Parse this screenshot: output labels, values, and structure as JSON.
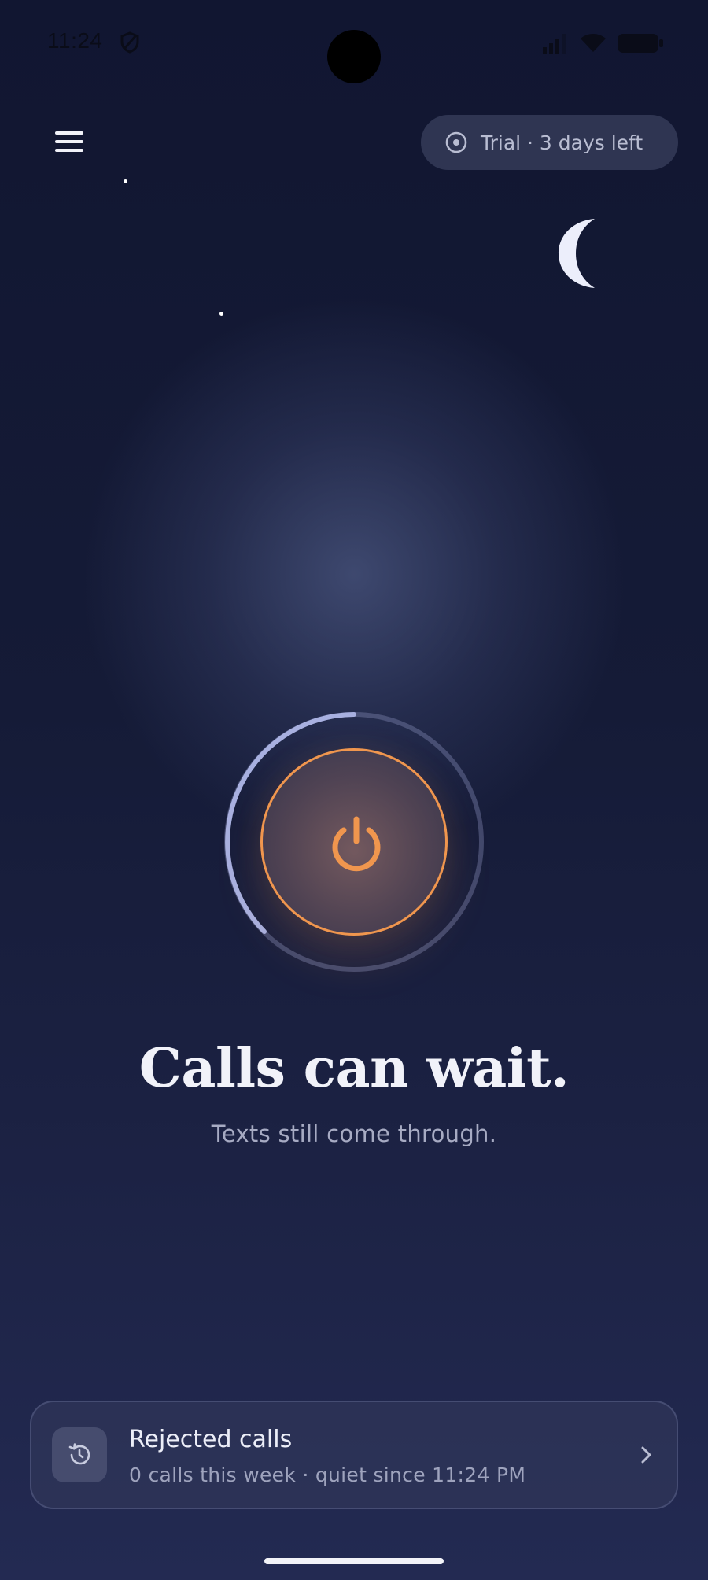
{
  "status_bar": {
    "time": "11:24",
    "icons": [
      "shield-icon",
      "signal-icon",
      "wifi-icon",
      "battery-icon"
    ]
  },
  "header": {
    "menu_icon": "hamburger-menu-icon",
    "trial": {
      "icon": "trial-timer-icon",
      "label": "Trial · 3 days left"
    }
  },
  "decor": {
    "moon_icon": "moon-icon",
    "stars": 2
  },
  "power": {
    "icon": "power-icon",
    "ring_progress": 0.35
  },
  "message": {
    "headline": "Calls can wait.",
    "subline": "Texts still come through."
  },
  "rejected_card": {
    "icon": "history-icon",
    "title": "Rejected calls",
    "subtitle": "0 calls this week · quiet since 11:24 PM",
    "chevron": "chevron-right-icon"
  },
  "colors": {
    "accent": "#f0964e",
    "ring": "#a8b0e0",
    "background_top": "#111631",
    "background_bottom": "#232a52"
  }
}
